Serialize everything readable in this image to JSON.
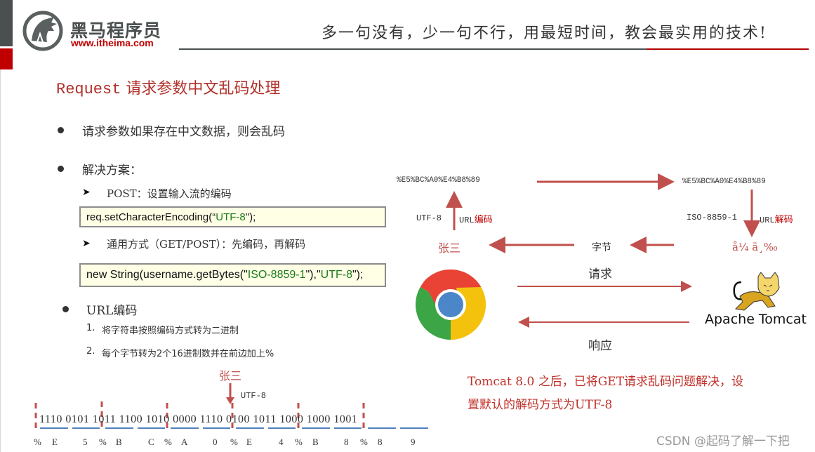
{
  "header": {
    "logo_cn": "黑马程序员",
    "logo_url": "www.itheima.com",
    "slogan": "多一句没有，少一句不行，用最短时间，教会最实用的技术!",
    "colors": {
      "brand_gray": "#4a4f4f",
      "brand_red": "#c00000"
    }
  },
  "slide": {
    "title_en": "Request",
    "title_cn": " 请求参数中文乱码处理",
    "bullets": [
      {
        "text": "请求参数如果存在中文数据，则会乱码"
      },
      {
        "text": "解决方案："
      },
      {
        "text": "URL编码"
      }
    ],
    "solutions": [
      {
        "label": "POST：设置输入流的编码",
        "code_prefix": "req.setCharacterEncoding(“",
        "code_green": "UTF-8",
        "code_suffix": "\");"
      },
      {
        "label": "通用方式（GET/POST）：先编码，再解码",
        "code_prefix": "new String(username.getBytes(\"",
        "code_green": "ISO-8859-1",
        "code_mid": "\"),\"",
        "code_green2": "UTF-8",
        "code_suffix": "\");"
      }
    ],
    "url_steps": [
      {
        "num": "1.",
        "text": "将字符串按照编码方式转为二进制"
      },
      {
        "num": "2.",
        "text": "每个字节转为2个16进制数并在前边加上%"
      }
    ],
    "encoding_example": {
      "source_text": "张三",
      "encoding": "UTF-8",
      "binary": "1110 0101 1011 1100 1010 0000 1110 0100 1011 1000 1000 1001",
      "hex_labels": [
        "%",
        "E",
        "5",
        "%",
        "B",
        "C",
        "%",
        "A",
        "0",
        "%",
        "E",
        "4",
        "%",
        "B",
        "8",
        "%",
        "8",
        "9"
      ]
    }
  },
  "diagram": {
    "encoded_left": "%E5%BC%A0%E4%B8%89",
    "encoded_right": "%E5%BC%A0%E4%B8%89",
    "left_charset": "UTF-8",
    "left_op_prefix": "URL",
    "left_op_suffix": "编码",
    "right_charset": "ISO-8859-1",
    "right_op_prefix": "URL",
    "right_op_suffix": "解码",
    "source_text": "张三",
    "bytes_label": "字节",
    "garbled_text": "å¼ ä¸‰",
    "request_label": "请求",
    "response_label": "响应",
    "client_icon": "chrome-browser-icon",
    "server_icon": "tomcat-icon",
    "server_label": "Apache Tomcat",
    "arrow_color": "#c0504d"
  },
  "note": {
    "line1": "Tomcat 8.0 之后，已将GET请求乱码问题解决，设",
    "line2": "置默认的解码方式为UTF-8"
  },
  "watermark": "CSDN @起码了解一下把"
}
